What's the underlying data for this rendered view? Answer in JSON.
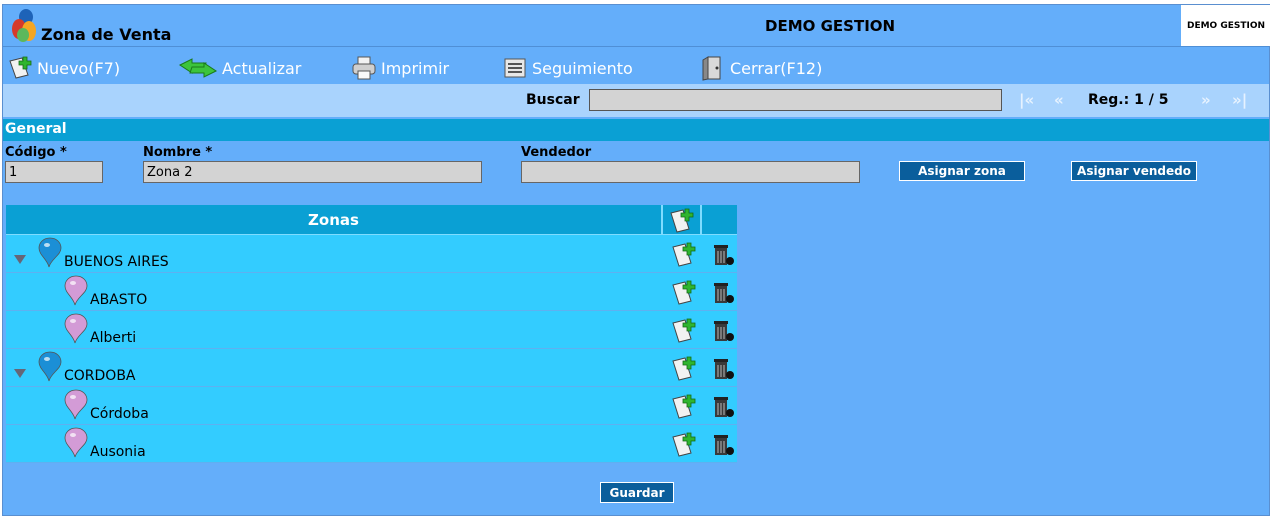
{
  "app": {
    "title": "Zona de Venta",
    "company": "DEMO GESTION",
    "company_logo_text": "DEMO GESTION"
  },
  "toolbar": {
    "items": [
      {
        "label": "Nuevo(F7)",
        "icon": "new-document-icon"
      },
      {
        "label": "Actualizar",
        "icon": "refresh-icon"
      },
      {
        "label": "Imprimir",
        "icon": "printer-icon"
      },
      {
        "label": "Seguimiento",
        "icon": "tracking-icon"
      },
      {
        "label": "Cerrar(F12)",
        "icon": "close-door-icon"
      }
    ]
  },
  "search": {
    "label": "Buscar",
    "value": "",
    "nav_first": "|«",
    "nav_prev": "«",
    "record_text": "Reg.: 1 / 5",
    "nav_next": "»",
    "nav_last": "»|"
  },
  "section": {
    "title": "General"
  },
  "form": {
    "codigo_label": "Código *",
    "codigo_value": "1",
    "nombre_label": "Nombre *",
    "nombre_value": "Zona 2",
    "vendedor_label": "Vendedor",
    "vendedor_value": "",
    "assign_zone_label": "Asignar zona",
    "assign_seller_label": "Asignar vendedo"
  },
  "tree": {
    "header": "Zonas",
    "rows": [
      {
        "label": "BUENOS AIRES",
        "level": 0,
        "expanded": true
      },
      {
        "label": "ABASTO",
        "level": 1
      },
      {
        "label": "Alberti",
        "level": 1
      },
      {
        "label": "CORDOBA",
        "level": 0,
        "expanded": true
      },
      {
        "label": "Córdoba",
        "level": 1
      },
      {
        "label": "Ausonia",
        "level": 1
      }
    ]
  },
  "save_label": "Guardar",
  "colors": {
    "background": "#64aefa",
    "header": "#0aa0d4",
    "tree_row": "#33ccff",
    "button": "#0a5e9c"
  }
}
